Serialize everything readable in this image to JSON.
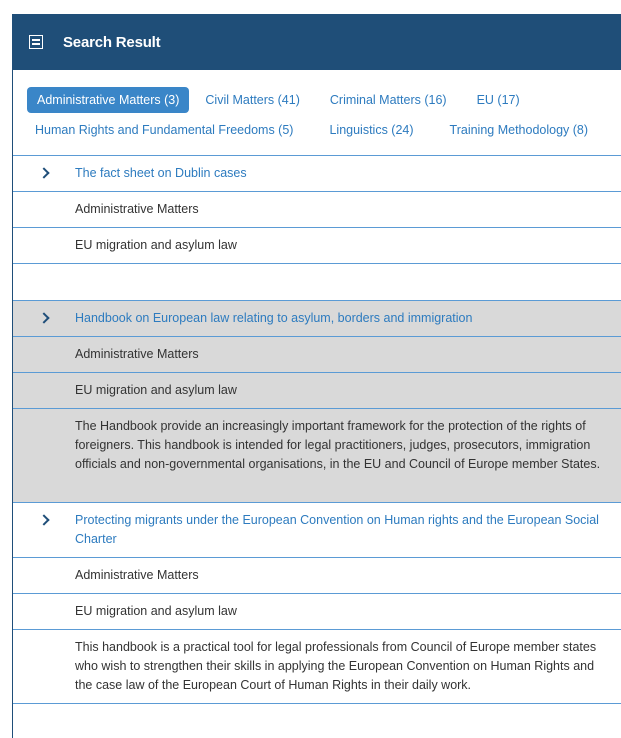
{
  "header": {
    "title": "Search Result",
    "icon": "list-icon"
  },
  "tabs": [
    {
      "label": "Administrative Matters (3)",
      "active": true
    },
    {
      "label": "Civil Matters (41)"
    },
    {
      "label": "Criminal Matters (16)"
    },
    {
      "label": "EU (17)"
    },
    {
      "label": "Human Rights and Fundamental Freedoms (5)"
    },
    {
      "label": "Linguistics (24)"
    },
    {
      "label": "Training Methodology (8)"
    }
  ],
  "results": [
    {
      "title": "The fact sheet on Dublin cases",
      "category": "Administrative Matters",
      "subcategory": "EU migration and asylum law"
    },
    {
      "title": "Handbook on European law relating to asylum, borders and immigration",
      "category": "Administrative Matters",
      "subcategory": "EU migration and asylum law",
      "description": "The Handbook provide an increasingly important framework for the protection of the rights of foreigners. This handbook is intended for legal practitioners, judges, prosecutors, immigration officials and non-governmental organisations, in the EU and Council of Europe member States."
    },
    {
      "title": "Protecting migrants under the European Convention on Human rights and the European Social Charter",
      "category": "Administrative Matters",
      "subcategory": "EU migration and asylum law",
      "description": "This handbook is a practical tool for legal professionals from Council of Europe member states who wish to strengthen their skills in applying the European Convention on Human Rights and the case law of the European Court of Human Rights in their daily work."
    }
  ]
}
